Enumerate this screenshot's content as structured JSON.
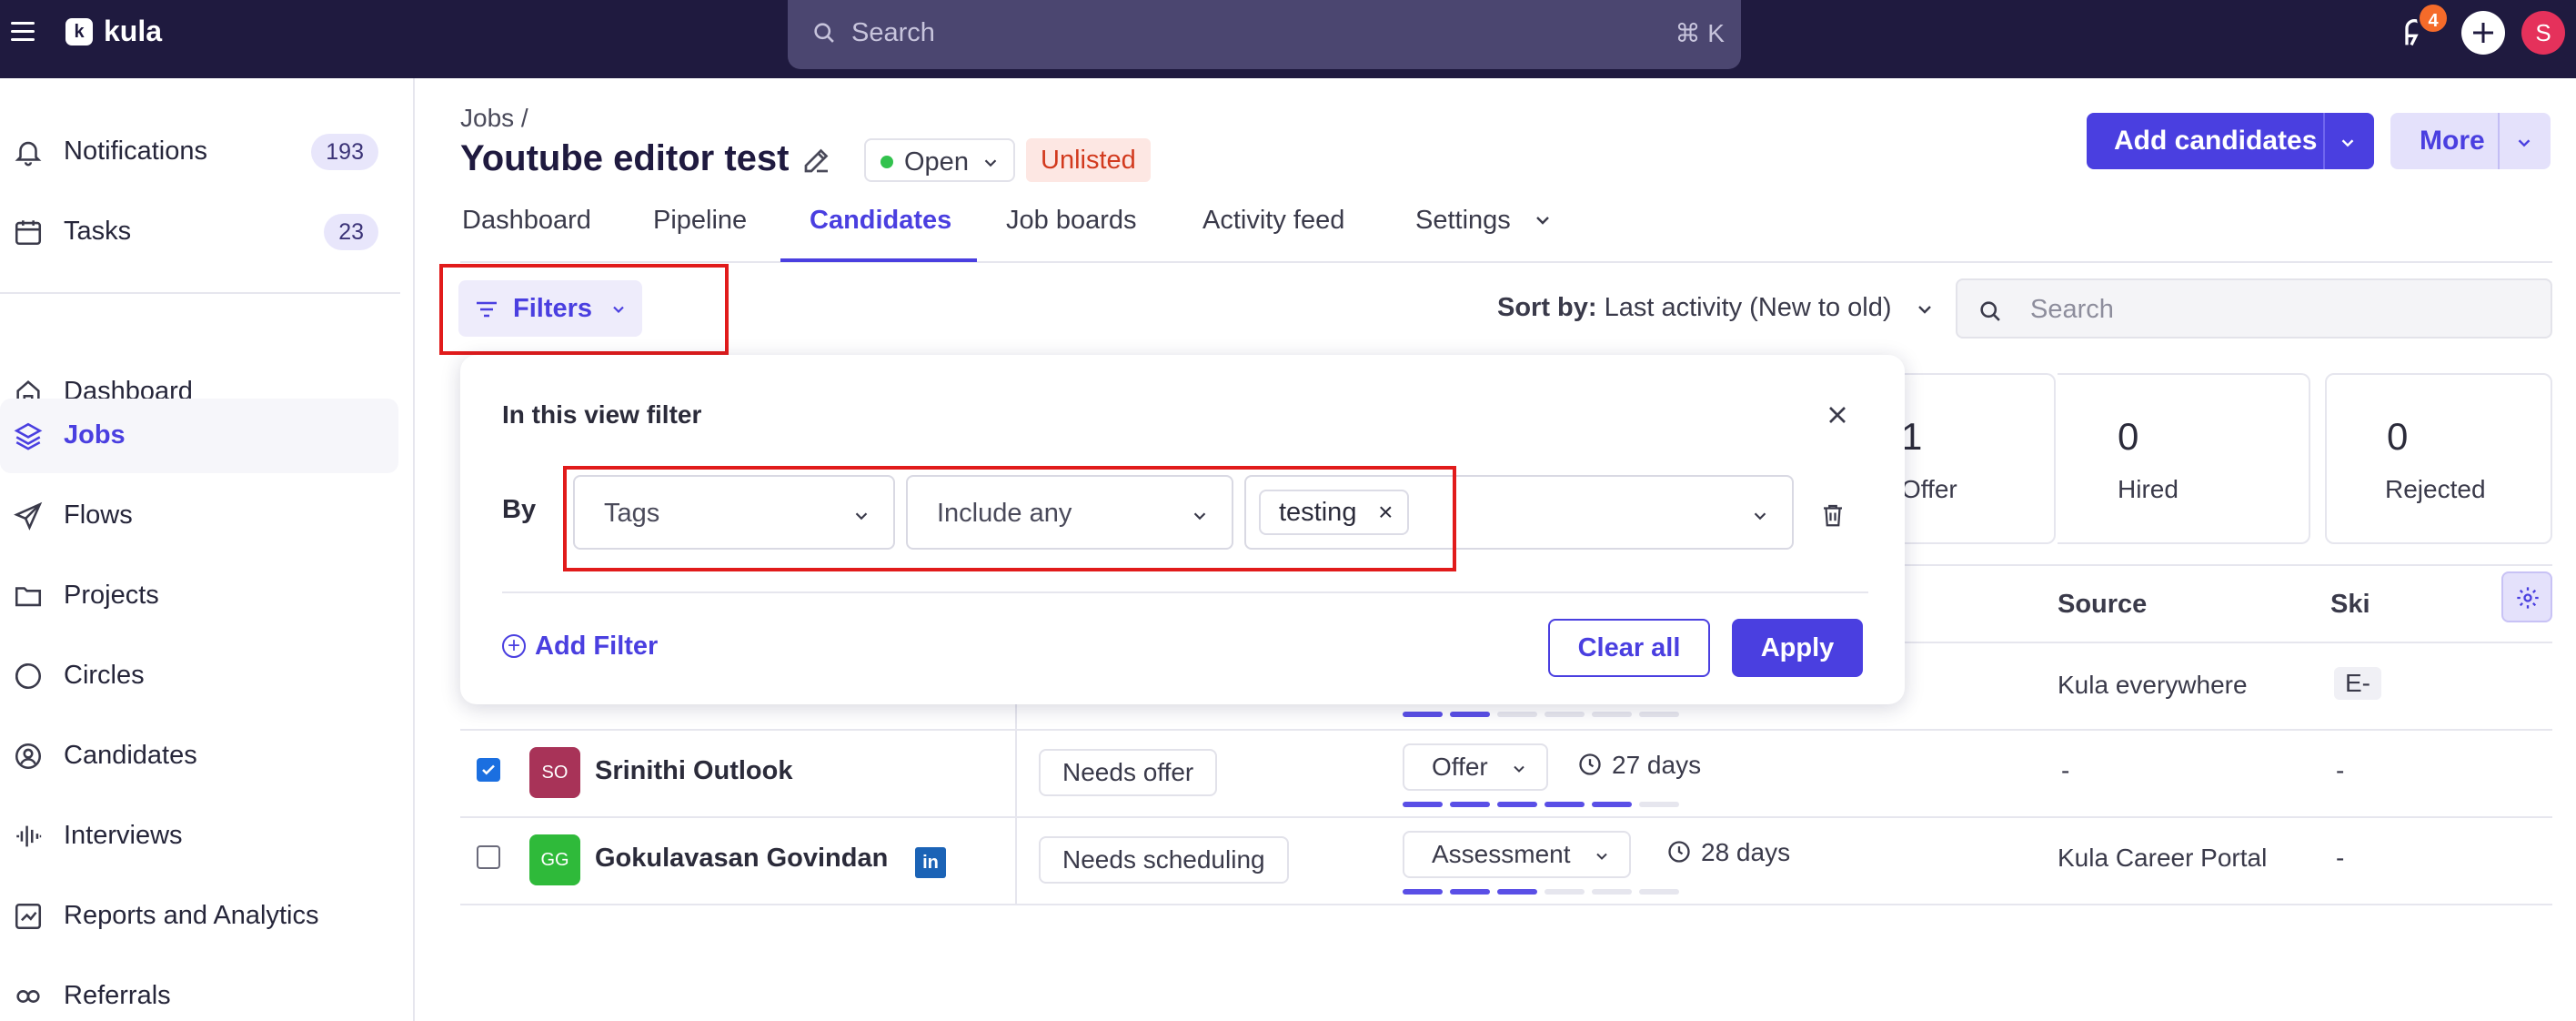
{
  "topbar": {
    "brand": "kula",
    "logo_letter": "k",
    "search_placeholder": "Search",
    "search_shortcut": "⌘ K",
    "notification_count": "4",
    "user_initial": "S",
    "colors": {
      "bar": "#1f1a3f",
      "accent": "#4a3fe0",
      "avatar": "#e5315b"
    }
  },
  "sidebar": {
    "items": [
      {
        "label": "Notifications",
        "count": "193",
        "icon": "bell-icon"
      },
      {
        "label": "Tasks",
        "count": "23",
        "icon": "calendar-icon"
      },
      {
        "label": "Dashboard",
        "icon": "home-icon"
      },
      {
        "label": "Jobs",
        "icon": "layers-icon",
        "active": true
      },
      {
        "label": "Flows",
        "icon": "send-icon"
      },
      {
        "label": "Projects",
        "icon": "folder-icon"
      },
      {
        "label": "Circles",
        "icon": "circles-icon"
      },
      {
        "label": "Candidates",
        "icon": "user-circle-icon"
      },
      {
        "label": "Interviews",
        "icon": "waveform-icon"
      },
      {
        "label": "Reports and Analytics",
        "icon": "chart-icon"
      },
      {
        "label": "Referrals",
        "icon": "referral-icon"
      }
    ]
  },
  "header": {
    "breadcrumb": "Jobs /",
    "title": "Youtube editor test",
    "status": "Open",
    "listing": "Unlisted",
    "add_candidates": "Add candidates",
    "more": "More"
  },
  "tabs": [
    "Dashboard",
    "Pipeline",
    "Candidates",
    "Job boards",
    "Activity feed",
    "Settings"
  ],
  "toolbar": {
    "filters": "Filters",
    "sort_prefix": "Sort by:",
    "sort_value": "Last activity (New to old)",
    "search_placeholder": "Search"
  },
  "stages": [
    {
      "count": "1",
      "label": "Offer"
    },
    {
      "count": "0",
      "label": "Hired"
    },
    {
      "count": "0",
      "label": "Rejected"
    }
  ],
  "table": {
    "headers": {
      "source": "Source",
      "skills": "Ski"
    },
    "rows": [
      {
        "name": "",
        "status": "",
        "stage": "",
        "days": "",
        "source": "Kula everywhere",
        "skills": "E-",
        "progress": 2
      },
      {
        "initials": "SO",
        "name": "Srinithi Outlook",
        "status": "Needs offer",
        "stage": "Offer",
        "days": "27 days",
        "source": "-",
        "skills": "-",
        "checked": true,
        "avatar_color": "#a83358",
        "progress": 5
      },
      {
        "initials": "GG",
        "name": "Gokulavasan Govindan",
        "status": "Needs scheduling",
        "stage": "Assessment",
        "days": "28 days",
        "source": "Kula Career Portal",
        "skills": "-",
        "checked": false,
        "avatar_color": "#2fba3a",
        "linkedin": "in",
        "progress": 3
      }
    ]
  },
  "filter_popover": {
    "title": "In this view filter",
    "by_label": "By",
    "field": "Tags",
    "operator": "Include any",
    "tag": "testing",
    "tag_remove": "×",
    "add_filter": "Add Filter",
    "clear_all": "Clear all",
    "apply": "Apply"
  }
}
